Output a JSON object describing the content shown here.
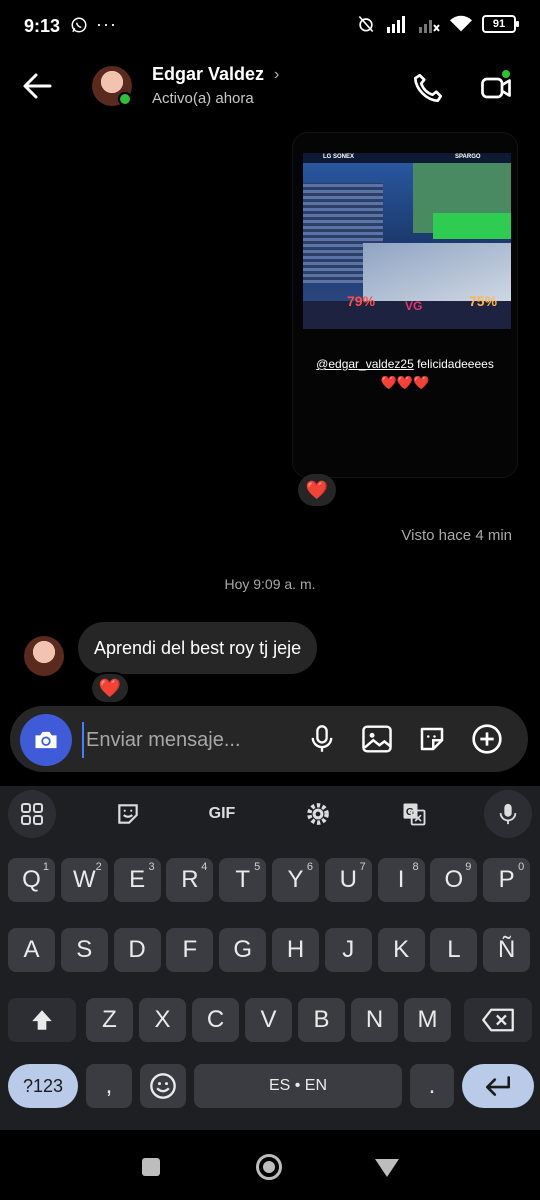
{
  "status_bar": {
    "time": "9:13",
    "battery": "91"
  },
  "header": {
    "name": "Edgar Valdez",
    "status": "Activo(a) ahora"
  },
  "story": {
    "mention_user": "@edgar_valdez25",
    "mention_text": " felicidadeeees",
    "hearts": "❤️❤️❤️",
    "game_hud": {
      "left_percent": "79%",
      "right_percent": "75%",
      "left_player": "LG SONEX",
      "right_player": "SPARGO"
    }
  },
  "thread": {
    "story_reaction": "❤️",
    "seen": "Visto hace 4 min",
    "date_divider": "Hoy 9:09 a. m.",
    "message_text": "Aprendi del best roy tj jeje",
    "message_reaction": "❤️"
  },
  "composer": {
    "placeholder": "Enviar mensaje..."
  },
  "keyboard": {
    "gif_label": "GIF",
    "row1": [
      {
        "k": "Q",
        "n": "1"
      },
      {
        "k": "W",
        "n": "2"
      },
      {
        "k": "E",
        "n": "3"
      },
      {
        "k": "R",
        "n": "4"
      },
      {
        "k": "T",
        "n": "5"
      },
      {
        "k": "Y",
        "n": "6"
      },
      {
        "k": "U",
        "n": "7"
      },
      {
        "k": "I",
        "n": "8"
      },
      {
        "k": "O",
        "n": "9"
      },
      {
        "k": "P",
        "n": "0"
      }
    ],
    "row2": [
      "A",
      "S",
      "D",
      "F",
      "G",
      "H",
      "J",
      "K",
      "L",
      "Ñ"
    ],
    "row3": [
      "Z",
      "X",
      "C",
      "V",
      "B",
      "N",
      "M"
    ],
    "symbols_label": "?123",
    "comma": ",",
    "space_label": "ES • EN",
    "period": "."
  }
}
